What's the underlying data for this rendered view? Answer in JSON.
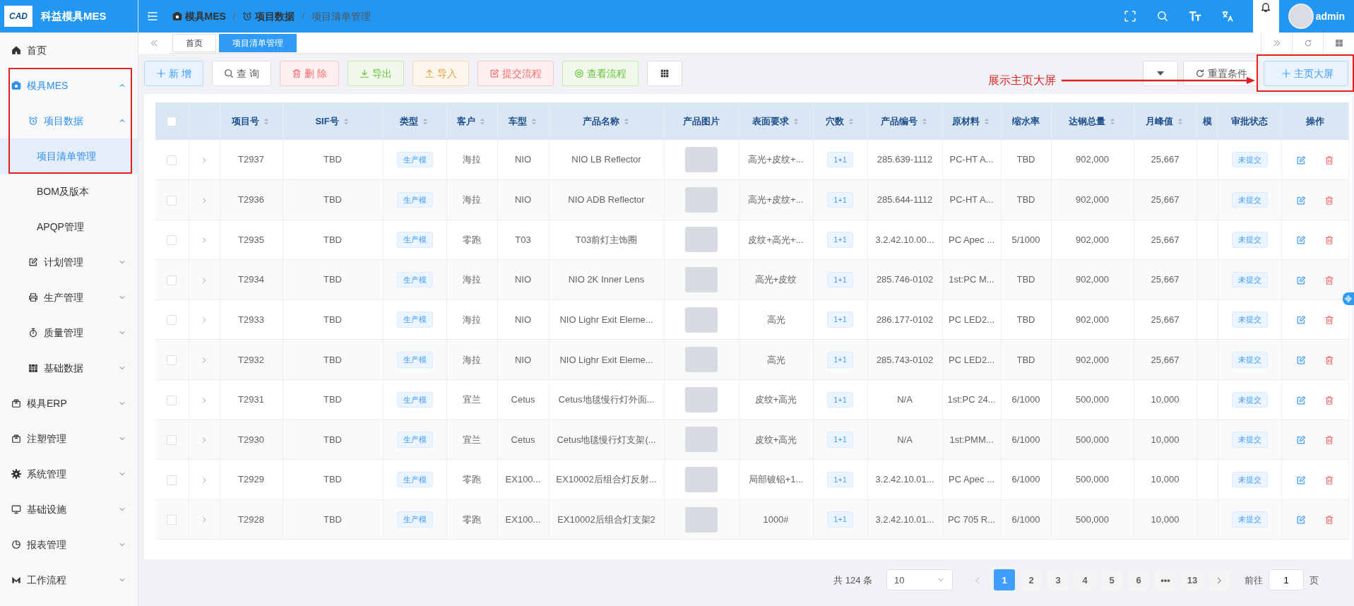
{
  "brand": {
    "logo_text": "CAD",
    "title": "科益模具MES"
  },
  "breadcrumb": [
    {
      "label": "模具MES"
    },
    {
      "separator": "/",
      "label": "项目数据"
    },
    {
      "separator": "/",
      "label": "项目清单管理"
    }
  ],
  "header": {
    "user": "admin"
  },
  "sidebar": {
    "items": [
      {
        "label": "首页",
        "selected": false
      },
      {
        "label": "模具MES",
        "selected": false,
        "expanded": true,
        "highlighted": true,
        "children": [
          {
            "label": "项目数据",
            "selected": false,
            "expanded": true,
            "highlighted": true,
            "children": [
              {
                "label": "项目清单管理",
                "selected": true,
                "highlighted": true
              },
              {
                "label": "BOM及版本",
                "selected": false,
                "highlighted": false
              },
              {
                "label": "APQP管理",
                "selected": false,
                "highlighted": false
              }
            ]
          },
          {
            "label": "计划管理",
            "selected": false,
            "expanded": false,
            "highlighted": false
          },
          {
            "label": "生产管理",
            "selected": false,
            "expanded": false,
            "highlighted": false
          },
          {
            "label": "质量管理",
            "selected": false,
            "expanded": false,
            "highlighted": false
          },
          {
            "label": "基础数据",
            "selected": false,
            "expanded": false,
            "highlighted": false
          }
        ]
      },
      {
        "label": "模具ERP",
        "selected": false,
        "expanded": false,
        "highlighted": false
      },
      {
        "label": "注塑管理",
        "selected": false,
        "expanded": false,
        "highlighted": false
      },
      {
        "label": "系统管理",
        "selected": false,
        "expanded": false,
        "highlighted": false
      },
      {
        "label": "基础设施",
        "selected": false,
        "expanded": false,
        "highlighted": false
      },
      {
        "label": "报表管理",
        "selected": false,
        "expanded": false,
        "highlighted": false
      },
      {
        "label": "工作流程",
        "selected": false,
        "expanded": false,
        "highlighted": false
      }
    ]
  },
  "tabs": [
    {
      "label": "首页",
      "selected": false
    },
    {
      "label": "项目清单管理",
      "selected": true
    }
  ],
  "toolbar": {
    "buttons": [
      {
        "label": "新 增",
        "kind": "primary"
      },
      {
        "label": "查 询",
        "kind": "search"
      },
      {
        "label": "删 除",
        "kind": "delete"
      },
      {
        "label": "导出",
        "kind": "export"
      },
      {
        "label": "导入",
        "kind": "import"
      },
      {
        "label": "提交流程",
        "kind": "submit"
      },
      {
        "label": "查看流程",
        "kind": "view"
      },
      {
        "kind": "grid"
      }
    ],
    "right_buttons": [
      {
        "kind": "dropdown",
        "highlighted": false
      },
      {
        "label": "重置条件",
        "kind": "reset",
        "highlighted": false
      },
      {
        "label": "主页大屏",
        "kind": "add",
        "highlighted": true
      }
    ]
  },
  "annotation": {
    "label": "展示主页大屏"
  },
  "table": {
    "header_checked": false,
    "columns": [
      {
        "label": "项目号",
        "sortable": true
      },
      {
        "label": "SIF号",
        "sortable": true
      },
      {
        "label": "类型",
        "sortable": true
      },
      {
        "label": "客户",
        "sortable": true
      },
      {
        "label": "车型",
        "sortable": true
      },
      {
        "label": "产品名称",
        "sortable": true
      },
      {
        "label": "产品图片",
        "sortable": false
      },
      {
        "label": "表面要求",
        "sortable": true
      },
      {
        "label": "穴数",
        "sortable": true
      },
      {
        "label": "产品编号",
        "sortable": true
      },
      {
        "label": "原材料",
        "sortable": true
      },
      {
        "label": "缩水率",
        "sortable": false
      },
      {
        "label": "达钢总量",
        "sortable": true
      },
      {
        "label": "月峰值",
        "sortable": true
      },
      {
        "label": "模",
        "sortable": false
      },
      {
        "label": "审批状态",
        "sortable": false
      },
      {
        "label": "操作",
        "sortable": false
      }
    ],
    "rows": [
      {
        "checked": false,
        "project_no": "T2937",
        "sif": "TBD",
        "type": "生产模",
        "customer": "海拉",
        "model": "NIO",
        "product_name": "NIO LB Reflector",
        "surface": "高光+皮纹+...",
        "cavities": "1+1",
        "product_code": "285.639-1112",
        "material": "PC-HT A...",
        "shrinkage": "TBD",
        "steel_total": "902,000",
        "monthly_peak": "25,667",
        "status": "未提交"
      },
      {
        "checked": false,
        "project_no": "T2936",
        "sif": "TBD",
        "type": "生产模",
        "customer": "海拉",
        "model": "NIO",
        "product_name": "NIO ADB Reflector",
        "surface": "高光+皮纹+...",
        "cavities": "1+1",
        "product_code": "285.644-1112",
        "material": "PC-HT A...",
        "shrinkage": "TBD",
        "steel_total": "902,000",
        "monthly_peak": "25,667",
        "status": "未提交"
      },
      {
        "checked": false,
        "project_no": "T2935",
        "sif": "TBD",
        "type": "生产模",
        "customer": "零跑",
        "model": "T03",
        "product_name": "T03前灯主饰圈",
        "surface": "皮纹+高光+...",
        "cavities": "1+1",
        "product_code": "3.2.42.10.00...",
        "material": "PC Apec ...",
        "shrinkage": "5/1000",
        "steel_total": "902,000",
        "monthly_peak": "25,667",
        "status": "未提交"
      },
      {
        "checked": false,
        "project_no": "T2934",
        "sif": "TBD",
        "type": "生产模",
        "customer": "海拉",
        "model": "NIO",
        "product_name": "NIO 2K Inner Lens",
        "surface": "高光+皮纹",
        "cavities": "1+1",
        "product_code": "285.746-0102",
        "material": "1st:PC M...",
        "shrinkage": "TBD",
        "steel_total": "902,000",
        "monthly_peak": "25,667",
        "status": "未提交"
      },
      {
        "checked": false,
        "project_no": "T2933",
        "sif": "TBD",
        "type": "生产模",
        "customer": "海拉",
        "model": "NIO",
        "product_name": "NIO Lighr Exit Eleme...",
        "surface": "高光",
        "cavities": "1+1",
        "product_code": "286.177-0102",
        "material": "PC LED2...",
        "shrinkage": "TBD",
        "steel_total": "902,000",
        "monthly_peak": "25,667",
        "status": "未提交"
      },
      {
        "checked": false,
        "project_no": "T2932",
        "sif": "TBD",
        "type": "生产模",
        "customer": "海拉",
        "model": "NIO",
        "product_name": "NIO Lighr Exit Eleme...",
        "surface": "高光",
        "cavities": "1+1",
        "product_code": "285.743-0102",
        "material": "PC LED2...",
        "shrinkage": "TBD",
        "steel_total": "902,000",
        "monthly_peak": "25,667",
        "status": "未提交"
      },
      {
        "checked": false,
        "project_no": "T2931",
        "sif": "TBD",
        "type": "生产模",
        "customer": "宜兰",
        "model": "Cetus",
        "product_name": "Cetus地毯慢行灯外面...",
        "surface": "皮纹+高光",
        "cavities": "1+1",
        "product_code": "N/A",
        "material": "1st:PC 24...",
        "shrinkage": "6/1000",
        "steel_total": "500,000",
        "monthly_peak": "10,000",
        "status": "未提交"
      },
      {
        "checked": false,
        "project_no": "T2930",
        "sif": "TBD",
        "type": "生产模",
        "customer": "宜兰",
        "model": "Cetus",
        "product_name": "Cetus地毯慢行灯支架(...",
        "surface": "皮纹+高光",
        "cavities": "1+1",
        "product_code": "N/A",
        "material": "1st:PMM...",
        "shrinkage": "6/1000",
        "steel_total": "500,000",
        "monthly_peak": "10,000",
        "status": "未提交"
      },
      {
        "checked": false,
        "project_no": "T2929",
        "sif": "TBD",
        "type": "生产模",
        "customer": "零跑",
        "model": "EX100...",
        "product_name": "EX10002后组合灯反射...",
        "surface": "局部镀铝+1...",
        "cavities": "1+1",
        "product_code": "3.2.42.10.01...",
        "material": "PC Apec ...",
        "shrinkage": "6/1000",
        "steel_total": "500,000",
        "monthly_peak": "10,000",
        "status": "未提交"
      },
      {
        "checked": false,
        "project_no": "T2928",
        "sif": "TBD",
        "type": "生产模",
        "customer": "零跑",
        "model": "EX100...",
        "product_name": "EX10002后组合灯支架2",
        "surface": "1000#",
        "cavities": "1+1",
        "product_code": "3.2.42.10.01...",
        "material": "PC 705 R...",
        "shrinkage": "6/1000",
        "steel_total": "500,000",
        "monthly_peak": "10,000",
        "status": "未提交"
      }
    ]
  },
  "pagination": {
    "total": "共 124 条",
    "page_size": "10",
    "pages": [
      {
        "label": "1",
        "selected": true
      },
      {
        "label": "2",
        "selected": false
      },
      {
        "label": "3",
        "selected": false
      },
      {
        "label": "4",
        "selected": false
      },
      {
        "label": "5",
        "selected": false
      },
      {
        "label": "6",
        "selected": false
      },
      {
        "label": "•••",
        "selected": false
      },
      {
        "label": "13",
        "selected": false
      }
    ],
    "goto_label": "前往",
    "goto_value": "1",
    "goto_suffix": "页"
  }
}
